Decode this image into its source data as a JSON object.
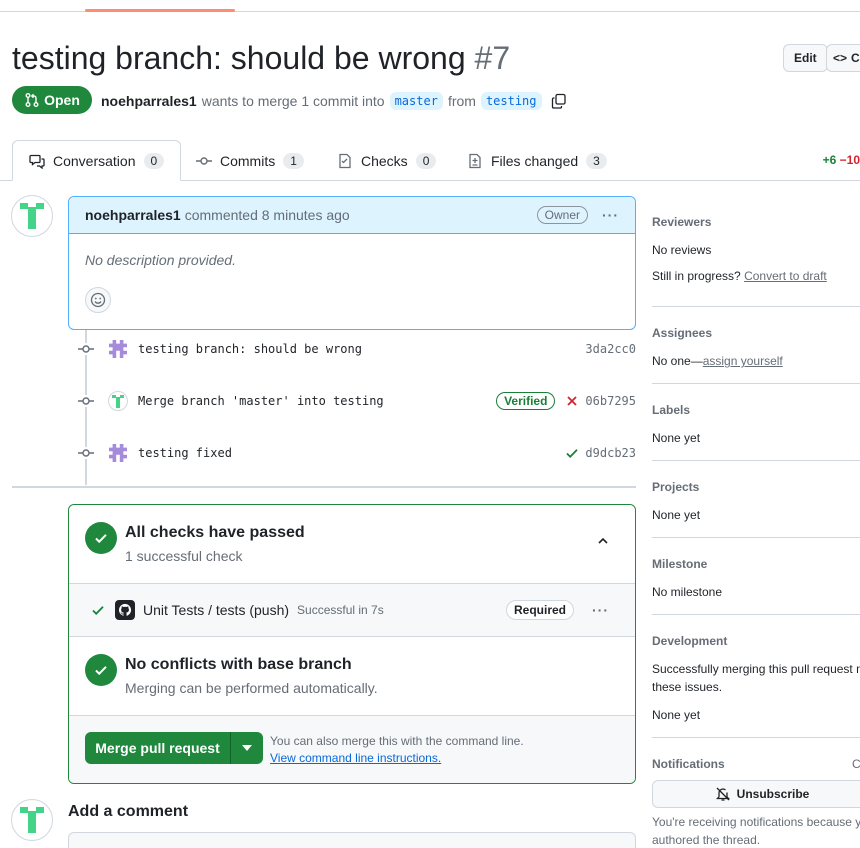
{
  "header": {
    "title": "testing branch: should be wrong",
    "number": "#7",
    "edit_label": "Edit",
    "code_label": "C"
  },
  "status": {
    "state_label": "Open",
    "author": "noehparrales1",
    "text1": "wants to merge 1 commit into",
    "base_branch": "master",
    "text2": "from",
    "head_branch": "testing"
  },
  "tabs": [
    {
      "label": "Conversation",
      "count": "0"
    },
    {
      "label": "Commits",
      "count": "1"
    },
    {
      "label": "Checks",
      "count": "0"
    },
    {
      "label": "Files changed",
      "count": "3"
    }
  ],
  "diffstat": {
    "additions": "+6",
    "deletions": "−10"
  },
  "comment": {
    "author": "noehparrales1",
    "action": "commented 8 minutes ago",
    "badge": "Owner",
    "body": "No description provided."
  },
  "commits": [
    {
      "message": "testing branch: should be wrong",
      "sha": "3da2cc0",
      "verified": "",
      "status": ""
    },
    {
      "message": "Merge branch 'master' into testing",
      "sha": "06b7295",
      "verified": "Verified",
      "status": "fail"
    },
    {
      "message": "testing fixed",
      "sha": "d9dcb23",
      "verified": "",
      "status": "pass"
    }
  ],
  "checks": {
    "title": "All checks have passed",
    "subtitle": "1 successful check",
    "item_name": "Unit Tests / tests (push)",
    "item_duration": "Successful in 7s",
    "item_badge": "Required"
  },
  "conflicts": {
    "title": "No conflicts with base branch",
    "subtitle": "Merging can be performed automatically."
  },
  "merge": {
    "button_label": "Merge pull request",
    "cli_text": "You can also merge this with the command line.",
    "cli_link": "View command line instructions."
  },
  "add_comment": {
    "title": "Add a comment"
  },
  "sidebar": {
    "reviewers": {
      "heading": "Reviewers",
      "value": "No reviews",
      "progress": "Still in progress?",
      "draft_link": "Convert to draft"
    },
    "assignees": {
      "heading": "Assignees",
      "value": "No one—",
      "link": "assign yourself"
    },
    "labels": {
      "heading": "Labels",
      "value": "None yet"
    },
    "projects": {
      "heading": "Projects",
      "value": "None yet"
    },
    "milestone": {
      "heading": "Milestone",
      "value": "No milestone"
    },
    "development": {
      "heading": "Development",
      "text1": "Successfully merging this pull request m",
      "text2": "these issues.",
      "value": "None yet"
    },
    "notifications": {
      "heading": "Notifications",
      "customize": "C",
      "button": "Unsubscribe",
      "text1": "You're receiving notifications because y",
      "text2": "authored the thread."
    }
  },
  "colors": {
    "success": "#1f883d",
    "accent": "#0969da",
    "danger": "#d1242f",
    "tab_underline": "#fd8c73"
  }
}
